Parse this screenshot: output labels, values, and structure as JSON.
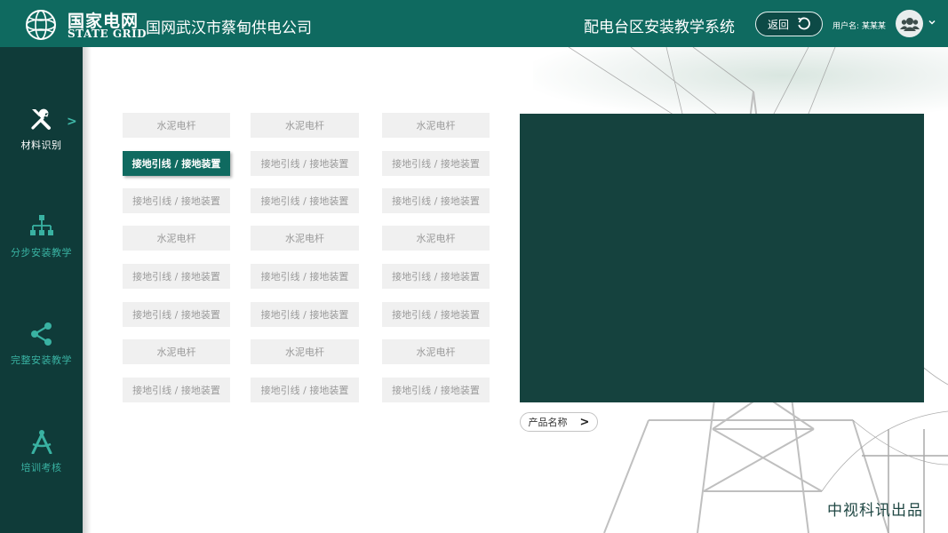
{
  "header": {
    "logo_cn": "国家电网",
    "logo_en": "STATE GRID",
    "company": "国网武汉市蔡甸供电公司",
    "system_title": "配电台区安装教学系统",
    "back_label": "返回",
    "user_label": "用户名: 某某某"
  },
  "sidebar": {
    "items": [
      {
        "label": "材料识别",
        "icon": "tools-icon",
        "active": true
      },
      {
        "label": "分步安装教学",
        "icon": "hierarchy-icon",
        "active": false
      },
      {
        "label": "完整安装教学",
        "icon": "share-icon",
        "active": false
      },
      {
        "label": "培训考核",
        "icon": "compass-icon",
        "active": false
      }
    ],
    "active_arrow": ">"
  },
  "materials": {
    "rows": [
      [
        "水泥电杆",
        "水泥电杆",
        "水泥电杆"
      ],
      [
        "接地引线 / 接地装置",
        "接地引线 / 接地装置",
        "接地引线 / 接地装置"
      ],
      [
        "接地引线 / 接地装置",
        "接地引线 / 接地装置",
        "接地引线 / 接地装置"
      ],
      [
        "水泥电杆",
        "水泥电杆",
        "水泥电杆"
      ],
      [
        "接地引线 / 接地装置",
        "接地引线 / 接地装置",
        "接地引线 / 接地装置"
      ],
      [
        "接地引线 / 接地装置",
        "接地引线 / 接地装置",
        "接地引线 / 接地装置"
      ],
      [
        "水泥电杆",
        "水泥电杆",
        "水泥电杆"
      ],
      [
        "接地引线 / 接地装置",
        "接地引线 / 接地装置",
        "接地引线 / 接地装置"
      ]
    ],
    "selected": {
      "row": 1,
      "col": 0
    }
  },
  "product": {
    "label": "产品名称",
    "arrow": ">"
  },
  "footer": {
    "brand": "中视科讯出品"
  },
  "colors": {
    "header_bg": "#0f6a60",
    "sidebar_bg": "#0f3b39",
    "accent": "#39b2a2",
    "preview_bg": "#15423e"
  }
}
